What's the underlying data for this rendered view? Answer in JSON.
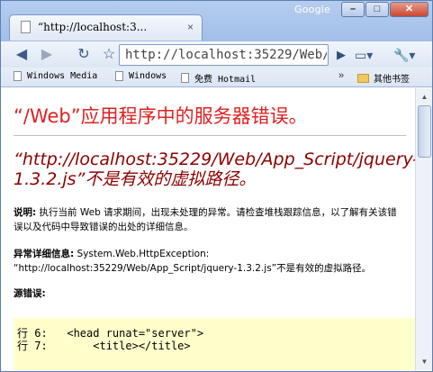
{
  "window": {
    "brand": "Google",
    "controls": [
      "–",
      "□",
      "✕"
    ]
  },
  "tab": {
    "title": "“http://localhost:3...",
    "close": "×"
  },
  "toolbar": {
    "back": "◀",
    "forward": "▶",
    "reload": "↻",
    "star": "☆",
    "url": "http://localhost:35229/Web/",
    "go": "▶",
    "page_menu": "▭▾",
    "tools_menu": "🔧▾"
  },
  "bookmarks": {
    "items": [
      "Windows Media",
      "Windows",
      "免费 Hotmail"
    ],
    "more": "»",
    "other": "其他书签"
  },
  "page": {
    "title": "“/Web”应用程序中的服务器错误。",
    "subtitle": "“http://localhost:35229/Web/App_Script/jquery-1.3.2.js”不是有效的虚拟路径。",
    "desc_label": "说明:",
    "desc_text": "执行当前 Web 请求期间，出现未处理的异常。请检查堆栈跟踪信息，以了解有关该错误以及代码中导致错误的出处的详细信息。",
    "exception_label": "异常详细信息:",
    "exception_type": "System.Web.HttpException:",
    "exception_text": "“http://localhost:35229/Web/App_Script/jquery-1.3.2.js”不是有效的虚拟路径。",
    "source_label": "源错误:",
    "code_lines": [
      "行 6:   <head runat=\"server\">",
      "行 7:       <title></title>"
    ]
  },
  "scrollbar": {
    "up": "▲",
    "down": "▼"
  }
}
